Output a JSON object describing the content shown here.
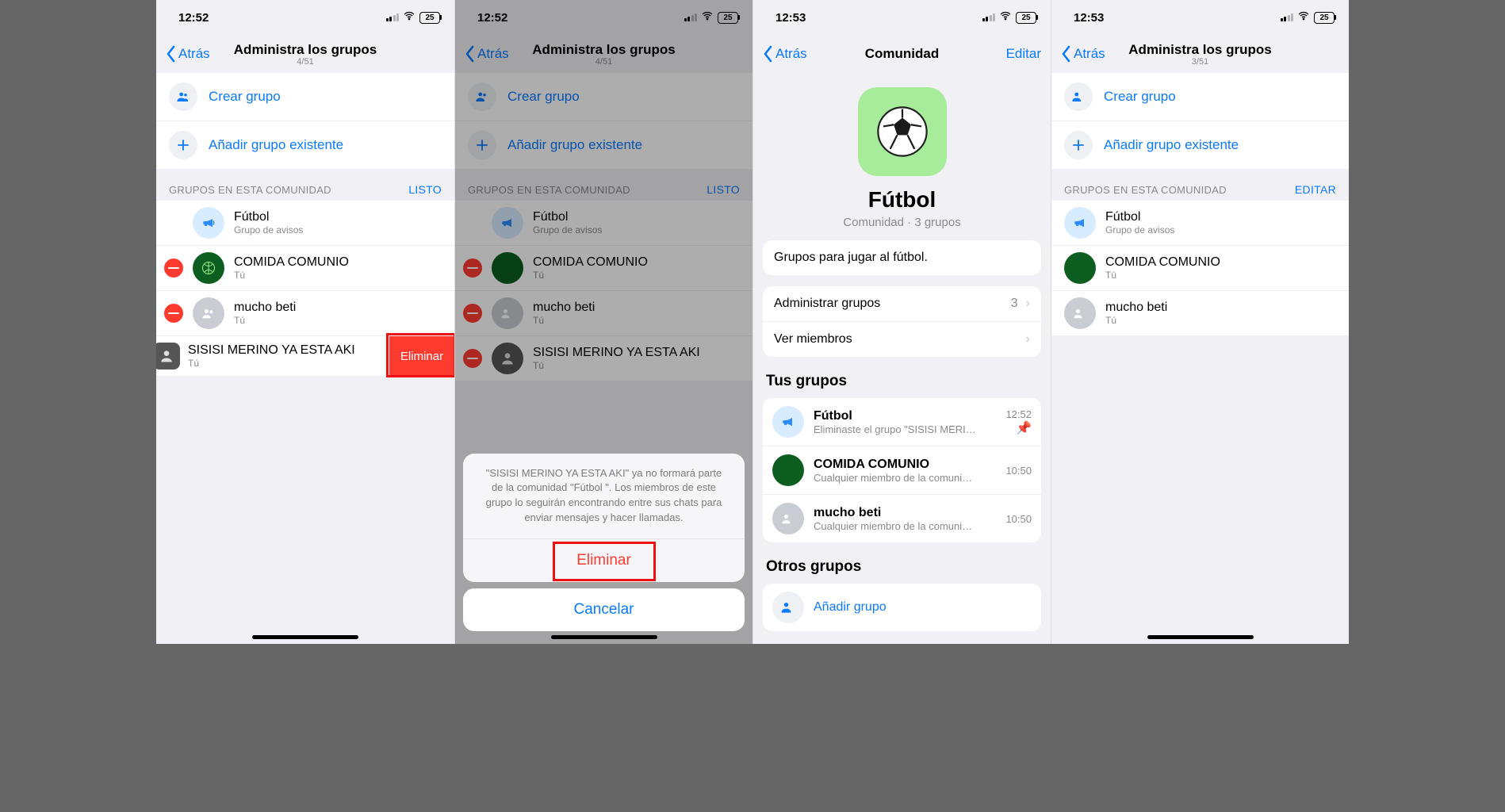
{
  "status": {
    "time1": "12:52",
    "time2": "12:52",
    "time3": "12:53",
    "time4": "12:53",
    "battery": "25"
  },
  "s1": {
    "back": "Atrás",
    "title": "Administra los grupos",
    "count": "4/51",
    "create": "Crear grupo",
    "add_existing": "Añadir grupo existente",
    "section_hdr": "GRUPOS EN ESTA COMUNIDAD",
    "section_action": "LISTO",
    "g1_name": "Fútbol",
    "g1_sub": "Grupo de avisos",
    "g2_name": "COMIDA COMUNIO",
    "g2_sub": "Tú",
    "g3_name": "mucho beti",
    "g3_sub": "Tú",
    "g4_name": "SISISI MERINO YA ESTA AKI",
    "g4_sub": "Tú",
    "swipe_label": "Eliminar"
  },
  "s2": {
    "back": "Atrás",
    "title": "Administra los grupos",
    "count": "4/51",
    "create": "Crear grupo",
    "add_existing": "Añadir grupo existente",
    "section_hdr": "GRUPOS EN ESTA COMUNIDAD",
    "section_action": "LISTO",
    "g1_name": "Fútbol",
    "g1_sub": "Grupo de avisos",
    "g2_name": "COMIDA COMUNIO",
    "g2_sub": "Tú",
    "g3_name": "mucho beti",
    "g3_sub": "Tú",
    "g4_name": "SISISI MERINO YA ESTA AKI",
    "g4_sub": "Tú",
    "sheet_msg": "\"SISISI MERINO YA ESTA AKI\" ya no formará parte de la comunidad \"Fútbol \". Los miembros de este grupo lo seguirán encontrando entre sus chats para enviar mensajes y hacer llamadas.",
    "sheet_destructive": "Eliminar",
    "sheet_cancel": "Cancelar"
  },
  "s3": {
    "back": "Atrás",
    "title": "Comunidad",
    "edit": "Editar",
    "community_name": "Fútbol",
    "community_sub": "Comunidad · 3 grupos",
    "description": "Grupos para jugar al fútbol.",
    "admin_groups": "Administrar grupos",
    "admin_groups_count": "3",
    "view_members": "Ver miembros",
    "your_groups": "Tus grupos",
    "g1_name": "Fútbol",
    "g1_sub": "Eliminaste el grupo \"SISISI MERI…",
    "g1_time": "12:52",
    "g2_name": "COMIDA COMUNIO",
    "g2_sub": "Cualquier miembro de la comuni…",
    "g2_time": "10:50",
    "g3_name": "mucho beti",
    "g3_sub": "Cualquier miembro de la comuni…",
    "g3_time": "10:50",
    "other_groups": "Otros grupos",
    "add_group": "Añadir grupo"
  },
  "s4": {
    "back": "Atrás",
    "title": "Administra los grupos",
    "count": "3/51",
    "create": "Crear grupo",
    "add_existing": "Añadir grupo existente",
    "section_hdr": "GRUPOS EN ESTA COMUNIDAD",
    "section_action": "EDITAR",
    "g1_name": "Fútbol",
    "g1_sub": "Grupo de avisos",
    "g2_name": "COMIDA COMUNIO",
    "g2_sub": "Tú",
    "g3_name": "mucho beti",
    "g3_sub": "Tú"
  }
}
